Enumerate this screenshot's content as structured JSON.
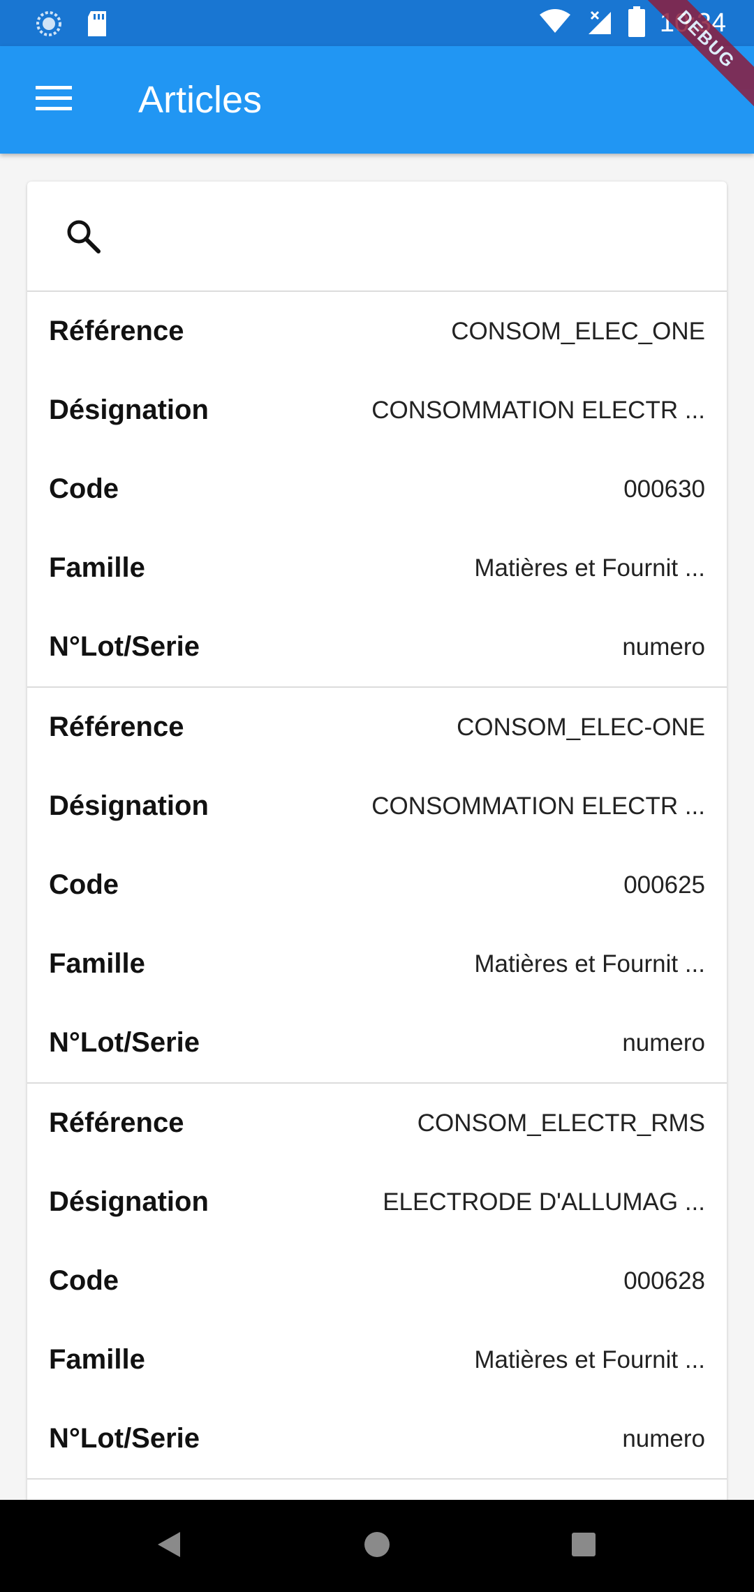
{
  "status_bar": {
    "time": "10:34",
    "icons": [
      "sync-icon",
      "sd-card-icon",
      "wifi-icon",
      "signal-icon",
      "battery-icon"
    ],
    "color": "#1976d2"
  },
  "debug_banner": "DEBUG",
  "app_bar": {
    "title": "Articles",
    "menu_icon": "menu-icon",
    "color": "#2196f3"
  },
  "search": {
    "icon": "search-icon",
    "value": ""
  },
  "articles": [
    {
      "reference": {
        "label": "Référence",
        "value": "CONSOM_ELEC_ONE"
      },
      "designation": {
        "label": "Désignation",
        "value": "CONSOMMATION ELECTR ..."
      },
      "code": {
        "label": "Code",
        "value": "000630"
      },
      "famille": {
        "label": "Famille",
        "value": "Matières et Fournit ..."
      },
      "lot": {
        "label": "N°Lot/Serie",
        "value": "numero"
      }
    },
    {
      "reference": {
        "label": "Référence",
        "value": "CONSOM_ELEC-ONE"
      },
      "designation": {
        "label": "Désignation",
        "value": "CONSOMMATION ELECTR ..."
      },
      "code": {
        "label": "Code",
        "value": "000625"
      },
      "famille": {
        "label": "Famille",
        "value": "Matières et Fournit ..."
      },
      "lot": {
        "label": "N°Lot/Serie",
        "value": "numero"
      }
    },
    {
      "reference": {
        "label": "Référence",
        "value": "CONSOM_ELECTR_RMS"
      },
      "designation": {
        "label": "Désignation",
        "value": "ELECTRODE D'ALLUMAG ..."
      },
      "code": {
        "label": "Code",
        "value": "000628"
      },
      "famille": {
        "label": "Famille",
        "value": "Matières et Fournit ..."
      },
      "lot": {
        "label": "N°Lot/Serie",
        "value": "numero"
      }
    }
  ],
  "nav_bar": {
    "buttons": [
      "back-icon",
      "home-icon",
      "recents-icon"
    ]
  }
}
